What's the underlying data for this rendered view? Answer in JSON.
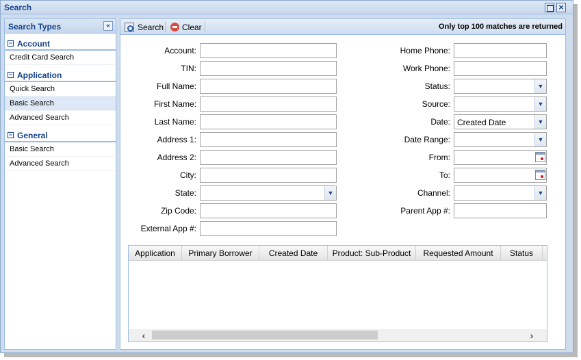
{
  "window": {
    "title": "Search"
  },
  "left_panel": {
    "title": "Search Types",
    "groups": [
      {
        "label": "Account",
        "items": [
          "Credit Card Search"
        ]
      },
      {
        "label": "Application",
        "items": [
          "Quick Search",
          "Basic Search",
          "Advanced Search"
        ]
      },
      {
        "label": "General",
        "items": [
          "Basic Search",
          "Advanced Search"
        ]
      }
    ],
    "selected": "Application / Basic Search"
  },
  "toolbar": {
    "search_label": "Search",
    "clear_label": "Clear",
    "note": "Only top 100 matches are returned"
  },
  "form": {
    "left": {
      "account": "Account:",
      "tin": "TIN:",
      "full_name": "Full Name:",
      "first_name": "First Name:",
      "last_name": "Last Name:",
      "address1": "Address 1:",
      "address2": "Address 2:",
      "city": "City:",
      "state": "State:",
      "zip": "Zip Code:",
      "external_app": "External App #:"
    },
    "right": {
      "home_phone": "Home Phone:",
      "work_phone": "Work Phone:",
      "status": "Status:",
      "source": "Source:",
      "date": "Date:",
      "date_value": "Created Date",
      "date_range": "Date Range:",
      "from": "From:",
      "to": "To:",
      "channel": "Channel:",
      "parent_app": "Parent App #:"
    }
  },
  "grid": {
    "columns": [
      "Application",
      "Primary Borrower",
      "Created Date",
      "Product: Sub-Product",
      "Requested Amount",
      "Status"
    ],
    "rows": []
  },
  "icons": {
    "group_toggle": "collapse-box-icon",
    "collapse_panel": "double-chevron-left-icon",
    "search": "search-icon",
    "clear": "no-entry-icon",
    "dropdown": "chevron-down-icon",
    "calendar": "calendar-icon"
  }
}
